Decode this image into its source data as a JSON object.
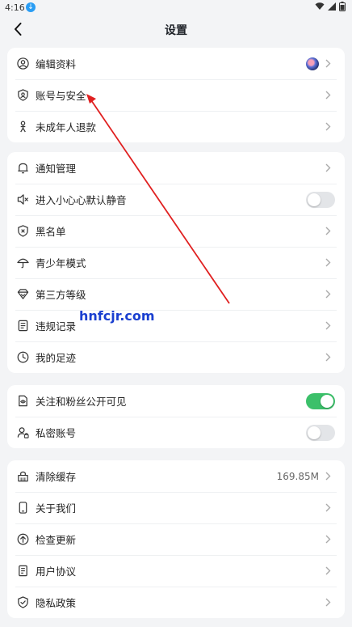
{
  "status_bar": {
    "time": "4:16",
    "download_glyph": "↓"
  },
  "header": {
    "title": "设置"
  },
  "groups": [
    {
      "items": [
        {
          "label": "编辑资料",
          "icon": "user-circle-icon",
          "trailing": "avatar"
        },
        {
          "label": "账号与安全",
          "icon": "shield-user-icon",
          "trailing": "chevron"
        },
        {
          "label": "未成年人退款",
          "icon": "person-icon",
          "trailing": "chevron"
        }
      ]
    },
    {
      "items": [
        {
          "label": "通知管理",
          "icon": "bell-icon",
          "trailing": "chevron"
        },
        {
          "label": "进入小心心默认静音",
          "icon": "mute-speaker-icon",
          "trailing": "toggle",
          "toggle_on": false
        },
        {
          "label": "黑名单",
          "icon": "blocked-shield-icon",
          "trailing": "chevron"
        },
        {
          "label": "青少年模式",
          "icon": "umbrella-icon",
          "trailing": "chevron"
        },
        {
          "label": "第三方等级",
          "icon": "diamond-icon",
          "trailing": "chevron"
        },
        {
          "label": "违规记录",
          "icon": "document-list-icon",
          "trailing": "chevron"
        },
        {
          "label": "我的足迹",
          "icon": "clock-icon",
          "trailing": "chevron"
        }
      ]
    },
    {
      "items": [
        {
          "label": "关注和粉丝公开可见",
          "icon": "eye-document-icon",
          "trailing": "toggle",
          "toggle_on": true
        },
        {
          "label": "私密账号",
          "icon": "private-user-icon",
          "trailing": "toggle",
          "toggle_on": false
        }
      ]
    },
    {
      "items": [
        {
          "label": "清除缓存",
          "icon": "broom-icon",
          "trailing": "value",
          "value": "169.85M"
        },
        {
          "label": "关于我们",
          "icon": "phone-icon",
          "trailing": "chevron"
        },
        {
          "label": "检查更新",
          "icon": "upload-circle-icon",
          "trailing": "chevron"
        },
        {
          "label": "用户协议",
          "icon": "document-icon",
          "trailing": "chevron"
        },
        {
          "label": "隐私政策",
          "icon": "privacy-shield-icon",
          "trailing": "chevron"
        }
      ]
    }
  ],
  "watermark": "hnfcjr.com",
  "colors": {
    "toggle_on": "#3cc06a",
    "toggle_off": "#e3e5e8",
    "annotation_arrow": "#e02020",
    "watermark": "#1a3fd0"
  }
}
